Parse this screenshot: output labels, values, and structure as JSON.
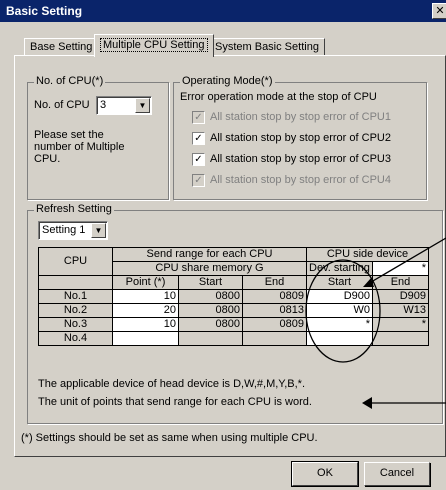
{
  "window": {
    "title": "Basic Setting"
  },
  "tabs": [
    {
      "label": "Base Setting"
    },
    {
      "label": "Multiple CPU Setting"
    },
    {
      "label": "System Basic Setting"
    }
  ],
  "no_of_cpu": {
    "group_label": "No. of CPU(*)",
    "field_label": "No. of CPU",
    "value": "3",
    "hint": [
      "Please set the",
      "number of Multiple",
      "CPU."
    ]
  },
  "operating_mode": {
    "group_label": "Operating Mode(*)",
    "description": "Error operation mode at the stop of CPU",
    "options": [
      {
        "label": "All station stop by stop error of CPU1",
        "checked": true,
        "enabled": false
      },
      {
        "label": "All station stop by stop error of CPU2",
        "checked": true,
        "enabled": true
      },
      {
        "label": "All station stop by stop error of CPU3",
        "checked": true,
        "enabled": true
      },
      {
        "label": "All station stop by stop error of CPU4",
        "checked": true,
        "enabled": false
      }
    ]
  },
  "refresh": {
    "group_label": "Refresh Setting",
    "selected": "Setting 1",
    "headers": {
      "cpu": "CPU",
      "send_range": "Send range for each CPU",
      "share_memory": "CPU share memory G",
      "point": "Point (*)",
      "start": "Start",
      "end": "End",
      "cpu_side": "CPU side device",
      "dev_starting": "Dev. starting",
      "dev_star": "*",
      "dev_start": "Start",
      "dev_end": "End"
    },
    "rows": [
      {
        "cpu": "No.1",
        "point": "10",
        "start": "0800",
        "end": "0809",
        "dev_start": "D900",
        "dev_end": "D909"
      },
      {
        "cpu": "No.2",
        "point": "20",
        "start": "0800",
        "end": "0813",
        "dev_start": "W0",
        "dev_end": "W13"
      },
      {
        "cpu": "No.3",
        "point": "10",
        "start": "0800",
        "end": "0809",
        "dev_start": "*",
        "dev_end": "*"
      },
      {
        "cpu": "No.4",
        "point": "",
        "start": "",
        "end": "",
        "dev_start": "",
        "dev_end": ""
      }
    ],
    "note1": "The applicable device of head device is D,W,#,M,Y,B,*.",
    "note2": "The unit of points that send range for each CPU is word."
  },
  "footer_note": "(*) Settings should be set as same when using multiple CPU.",
  "buttons": {
    "ok": "OK",
    "cancel": "Cancel"
  }
}
